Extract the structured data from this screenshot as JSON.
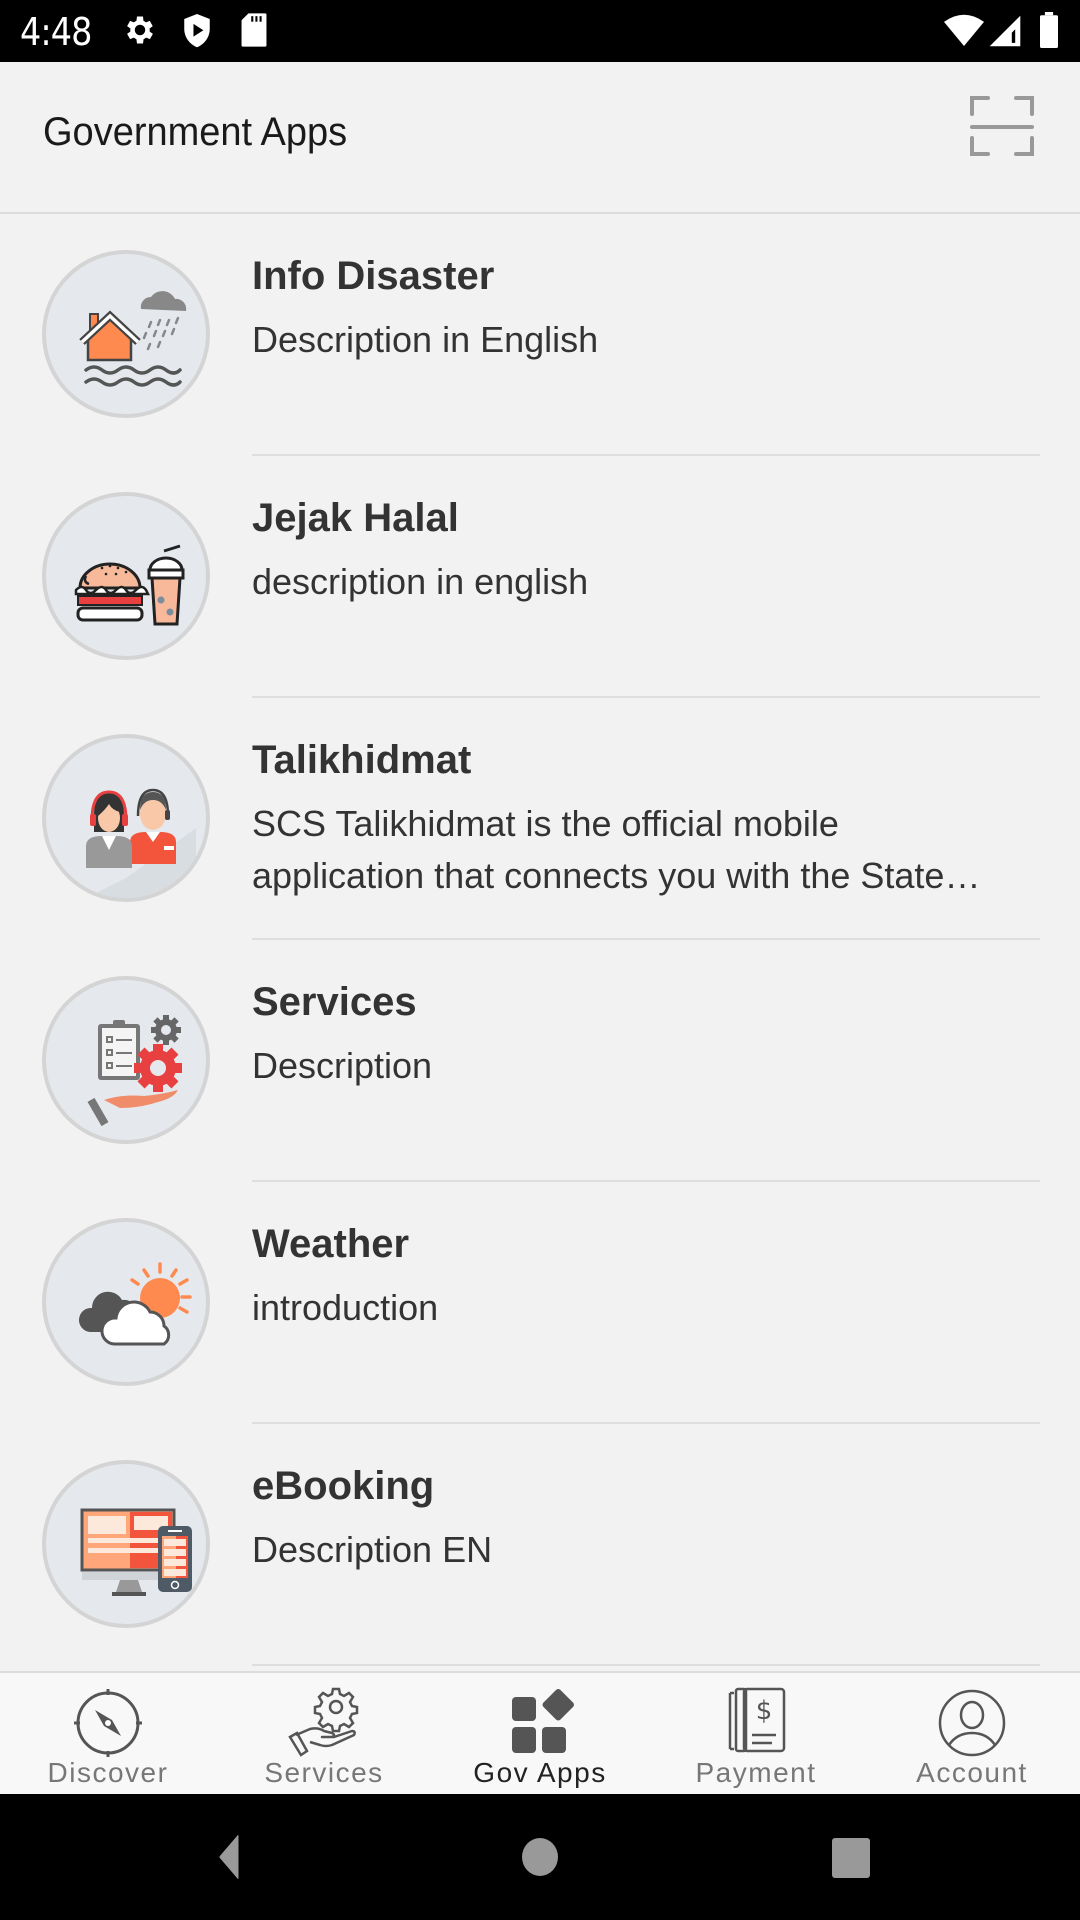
{
  "status_bar": {
    "time": "4:48",
    "left_icons": [
      "settings-icon",
      "shield-play-icon",
      "sd-card-icon"
    ],
    "right_icons": [
      "wifi-icon",
      "signal-icon",
      "battery-icon"
    ]
  },
  "app_bar": {
    "title": "Government Apps",
    "action_icon": "qr-scan-icon"
  },
  "apps": [
    {
      "title": "Info Disaster",
      "description": "Description in English",
      "icon": "flood-disaster-icon"
    },
    {
      "title": "Jejak Halal",
      "description": "description in english",
      "icon": "burger-drink-icon"
    },
    {
      "title": "Talikhidmat",
      "description": "SCS Talikhidmat is the official mobile application that connects you with the State Government of Sarawak and its agencies",
      "icon": "call-center-agents-icon"
    },
    {
      "title": "Services",
      "description": "Description",
      "icon": "service-checklist-gear-icon"
    },
    {
      "title": "Weather",
      "description": "introduction",
      "icon": "cloud-sun-icon"
    },
    {
      "title": "eBooking",
      "description": "Description EN",
      "icon": "desktop-mobile-icon"
    }
  ],
  "bottom_nav": {
    "active": "Gov Apps",
    "items": [
      {
        "label": "Discover",
        "icon": "compass-icon"
      },
      {
        "label": "Services",
        "icon": "hand-gear-icon"
      },
      {
        "label": "Gov Apps",
        "icon": "apps-grid-icon"
      },
      {
        "label": "Payment",
        "icon": "bill-dollar-icon"
      },
      {
        "label": "Account",
        "icon": "user-circle-icon"
      }
    ]
  },
  "colors": {
    "background": "#f2f2f2",
    "text_primary": "#333333",
    "accent_orange": "#ff8a50",
    "accent_red": "#e84040",
    "icon_gray": "#555555"
  }
}
